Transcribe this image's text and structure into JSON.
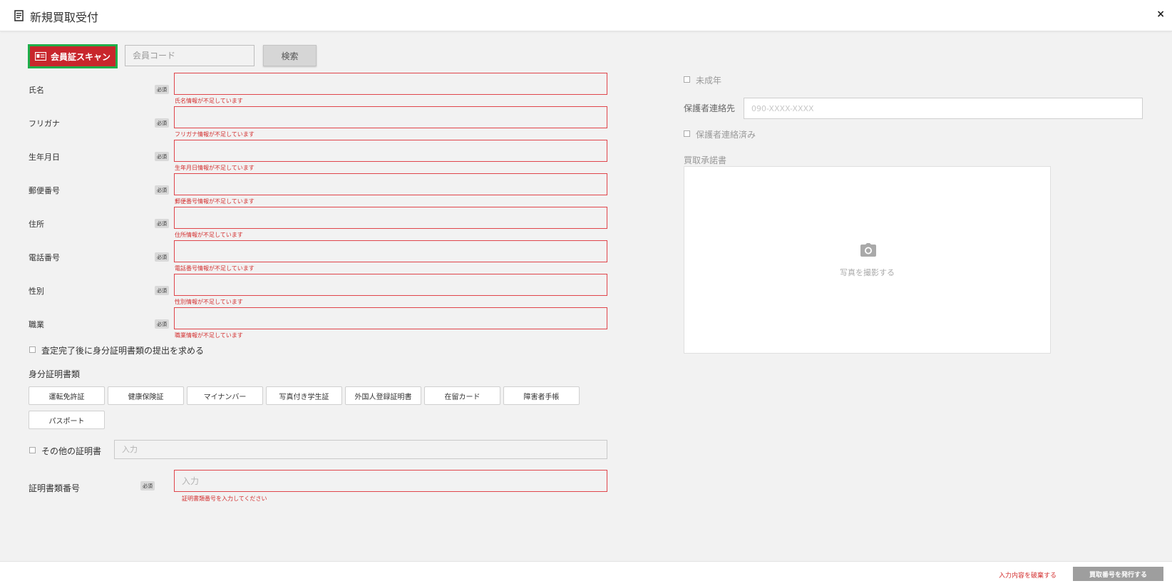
{
  "header": {
    "title": "新規買取受付",
    "close_label": "×"
  },
  "scan": {
    "label": "会員証スキャン",
    "member_code_placeholder": "会員コード",
    "search_label": "検索"
  },
  "required_label": "必須",
  "fields": [
    {
      "label": "氏名",
      "error": "氏名情報が不足しています"
    },
    {
      "label": "フリガナ",
      "error": "フリガナ情報が不足しています"
    },
    {
      "label": "生年月日",
      "error": "生年月日情報が不足しています"
    },
    {
      "label": "郵便番号",
      "error": "郵便番号情報が不足しています"
    },
    {
      "label": "住所",
      "error": "住所情報が不足しています"
    },
    {
      "label": "電話番号",
      "error": "電話番号情報が不足しています"
    },
    {
      "label": "性別",
      "error": "性別情報が不足しています"
    },
    {
      "label": "職業",
      "error": "職業情報が不足しています"
    }
  ],
  "require_id_after": "査定完了後に身分証明書類の提出を求める",
  "id_docs": {
    "title": "身分証明書類",
    "options": [
      "運転免許証",
      "健康保険証",
      "マイナンバー",
      "写真付き学生証",
      "外国人登録証明書",
      "在留カード",
      "障害者手帳",
      "パスポート"
    ]
  },
  "other_cert": {
    "label": "その他の証明書",
    "placeholder": "入力"
  },
  "cert_number": {
    "label": "証明書類番号",
    "placeholder": "入力",
    "error": "証明書類番号を入力してください"
  },
  "right": {
    "minor_label": "未成年",
    "guardian_label": "保護者連絡先",
    "guardian_placeholder": "090-XXXX-XXXX",
    "guardian_contacted": "保護者連絡済み",
    "consent_label": "買取承諾書",
    "photo_label": "写真を撮影する"
  },
  "footer": {
    "discard_label": "入力内容を破棄する",
    "issue_label": "買取番号を発行する"
  },
  "colors": {
    "accent_red": "#c8262c",
    "highlight_green": "#1fae4a",
    "error_red": "#d32f2f"
  }
}
